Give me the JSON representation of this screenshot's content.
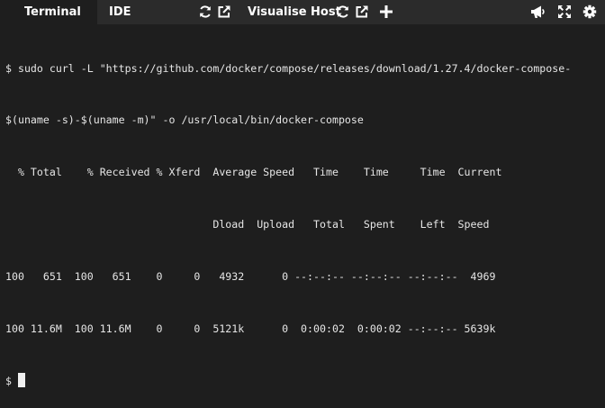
{
  "tabs": {
    "terminal": "Terminal",
    "ide": "IDE",
    "visualise_host": "Visualise Host"
  },
  "icons": {
    "refresh": "refresh-icon",
    "open_external": "external-link-icon",
    "add": "plus-icon",
    "announce": "megaphone-icon",
    "fullscreen": "expand-icon",
    "settings": "gear-icon"
  },
  "colors": {
    "tabbar_bg": "#2b2b2b",
    "terminal_bg": "#1e1e1e",
    "text": "#e6e6e6"
  },
  "terminal": {
    "lines": [
      "$ sudo curl -L \"https://github.com/docker/compose/releases/download/1.27.4/docker-compose-",
      "$(uname -s)-$(uname -m)\" -o /usr/local/bin/docker-compose",
      "  % Total    % Received % Xferd  Average Speed   Time    Time     Time  Current",
      "                                 Dload  Upload   Total   Spent    Left  Speed",
      "100   651  100   651    0     0   4932      0 --:--:-- --:--:-- --:--:--  4969",
      "100 11.6M  100 11.6M    0     0  5121k      0  0:00:02  0:00:02 --:--:-- 5639k"
    ],
    "prompt": "$ "
  }
}
